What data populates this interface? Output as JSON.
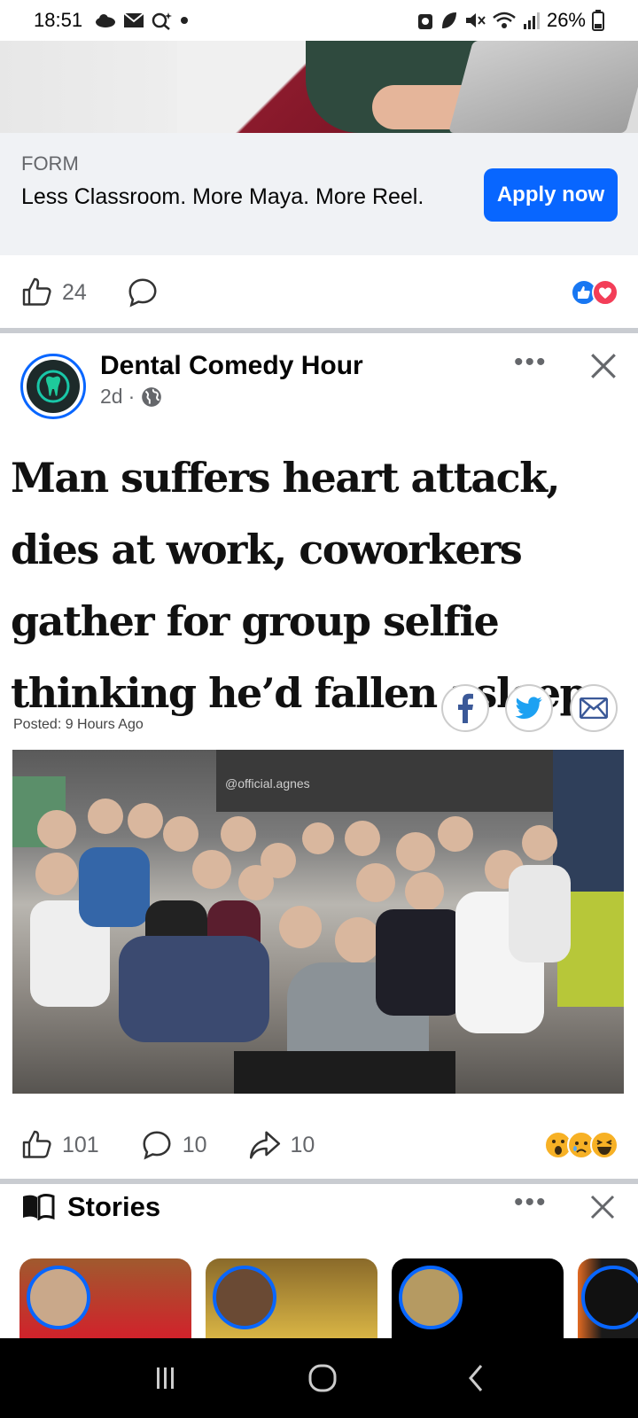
{
  "status_bar": {
    "time": "18:51",
    "battery": "26%"
  },
  "ad": {
    "kind": "FORM",
    "headline": "Less Classroom. More Maya. More Reel.",
    "cta_label": "Apply now",
    "like_count": "24"
  },
  "post": {
    "author": "Dental Comedy Hour",
    "age": "2d",
    "headline": "Man suffers heart attack, dies at work, coworkers gather for group selfie thinking he’d fallen asleep",
    "posted": "Posted: 9 Hours Ago",
    "watermark": "@official.agnes",
    "like_count": "101",
    "comment_count": "10",
    "share_count": "10"
  },
  "stories": {
    "title": "Stories"
  },
  "colors": {
    "accent": "#0866ff",
    "separator": "#c9ccd1",
    "muted_text": "#65676b"
  }
}
